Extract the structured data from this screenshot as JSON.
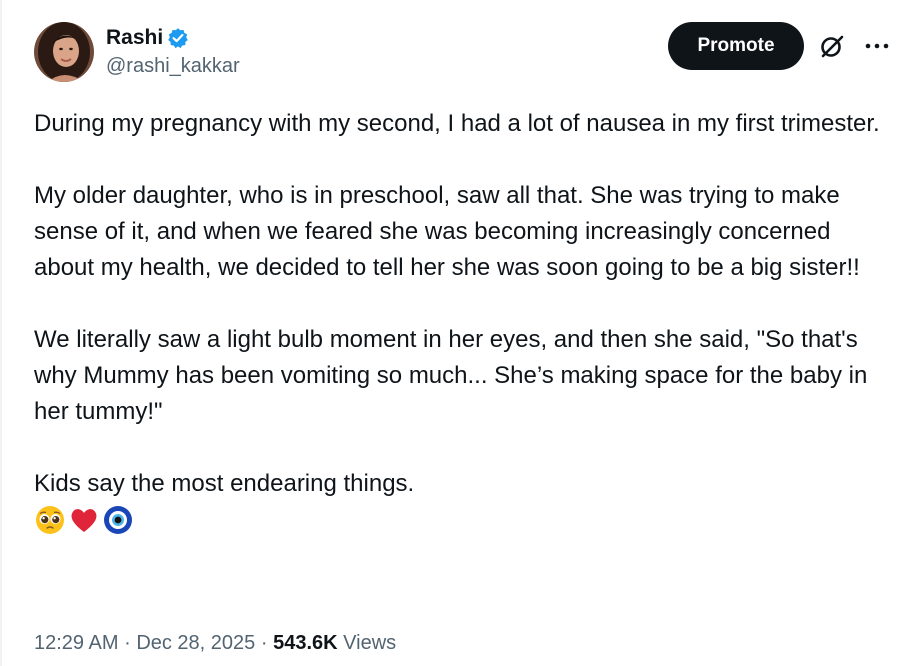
{
  "author": {
    "display_name": "Rashi",
    "handle": "@rashi_kakkar",
    "verified": true
  },
  "actions": {
    "promote_label": "Promote",
    "grok_icon": "grok-slash-icon",
    "more_icon": "more-dots-icon"
  },
  "post": {
    "paragraph_1": "During my pregnancy with my second, I had a lot of nausea in my first trimester.",
    "paragraph_2": "My older daughter, who is in preschool, saw all that. She was trying to make sense of it, and when we feared she was becoming increasingly concerned about my health, we decided to tell her she was soon going to be a big sister!!",
    "paragraph_3": "We literally saw a light bulb moment in her eyes, and then she said, \"So that's why Mummy has been vomiting so much... She’s making space for the baby in her tummy!\"",
    "paragraph_4": "Kids say the most endearing things.",
    "emojis": [
      "pleading-face-emoji",
      "red-heart-emoji",
      "nazar-amulet-emoji"
    ]
  },
  "meta": {
    "time": "12:29 AM",
    "separator": "·",
    "date": "Dec 28, 2025",
    "views_count": "543.6K",
    "views_label": "Views"
  },
  "colors": {
    "text_primary": "#0f1419",
    "text_secondary": "#536471",
    "verified_blue": "#1d9bf0",
    "button_bg": "#0f1419"
  }
}
